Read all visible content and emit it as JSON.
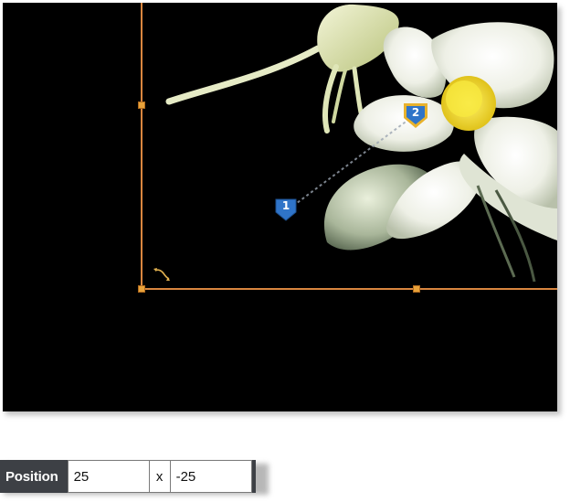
{
  "canvas": {
    "background": "#000000",
    "bbox_color": "#d9863f",
    "markers": [
      {
        "label": "1",
        "color": "#2f74c8"
      },
      {
        "label": "2",
        "color": "#2f74c8",
        "outline": "#e8b22c"
      }
    ],
    "rotate_icon": "rotate-arrows-icon"
  },
  "position_bar": {
    "label": "Position",
    "x_value": "25",
    "separator": "x",
    "y_value": "-25"
  }
}
